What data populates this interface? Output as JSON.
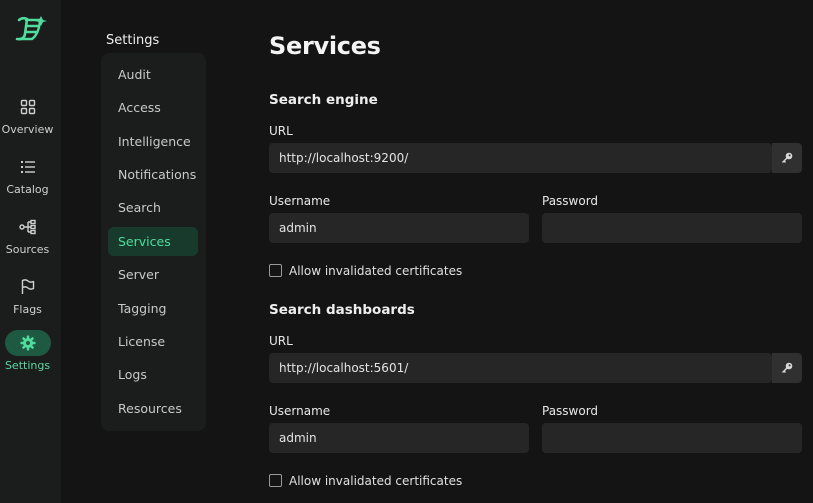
{
  "nav": {
    "items": [
      {
        "label": "Overview",
        "icon": "grid-icon"
      },
      {
        "label": "Catalog",
        "icon": "list-icon"
      },
      {
        "label": "Sources",
        "icon": "sources-icon"
      },
      {
        "label": "Flags",
        "icon": "flag-icon"
      },
      {
        "label": "Settings",
        "icon": "gear-icon",
        "active": true
      }
    ]
  },
  "settings_menu": {
    "title": "Settings",
    "items": [
      "Audit",
      "Access",
      "Intelligence",
      "Notifications",
      "Search",
      "Services",
      "Server",
      "Tagging",
      "License",
      "Logs",
      "Resources"
    ],
    "active": "Services"
  },
  "page": {
    "title": "Services",
    "search_engine": {
      "title": "Search engine",
      "url_label": "URL",
      "url_value": "http://localhost:9200/",
      "username_label": "Username",
      "username_value": "admin",
      "password_label": "Password",
      "password_value": "",
      "checkbox_label": "Allow invalidated certificates"
    },
    "search_dashboards": {
      "title": "Search dashboards",
      "url_label": "URL",
      "url_value": "http://localhost:5601/",
      "username_label": "Username",
      "username_value": "admin",
      "password_label": "Password",
      "password_value": "",
      "checkbox_label": "Allow invalidated certificates"
    }
  },
  "colors": {
    "accent": "#4fdc9c",
    "background": "#141414",
    "panel": "#1b1d1c",
    "input": "#262626"
  }
}
